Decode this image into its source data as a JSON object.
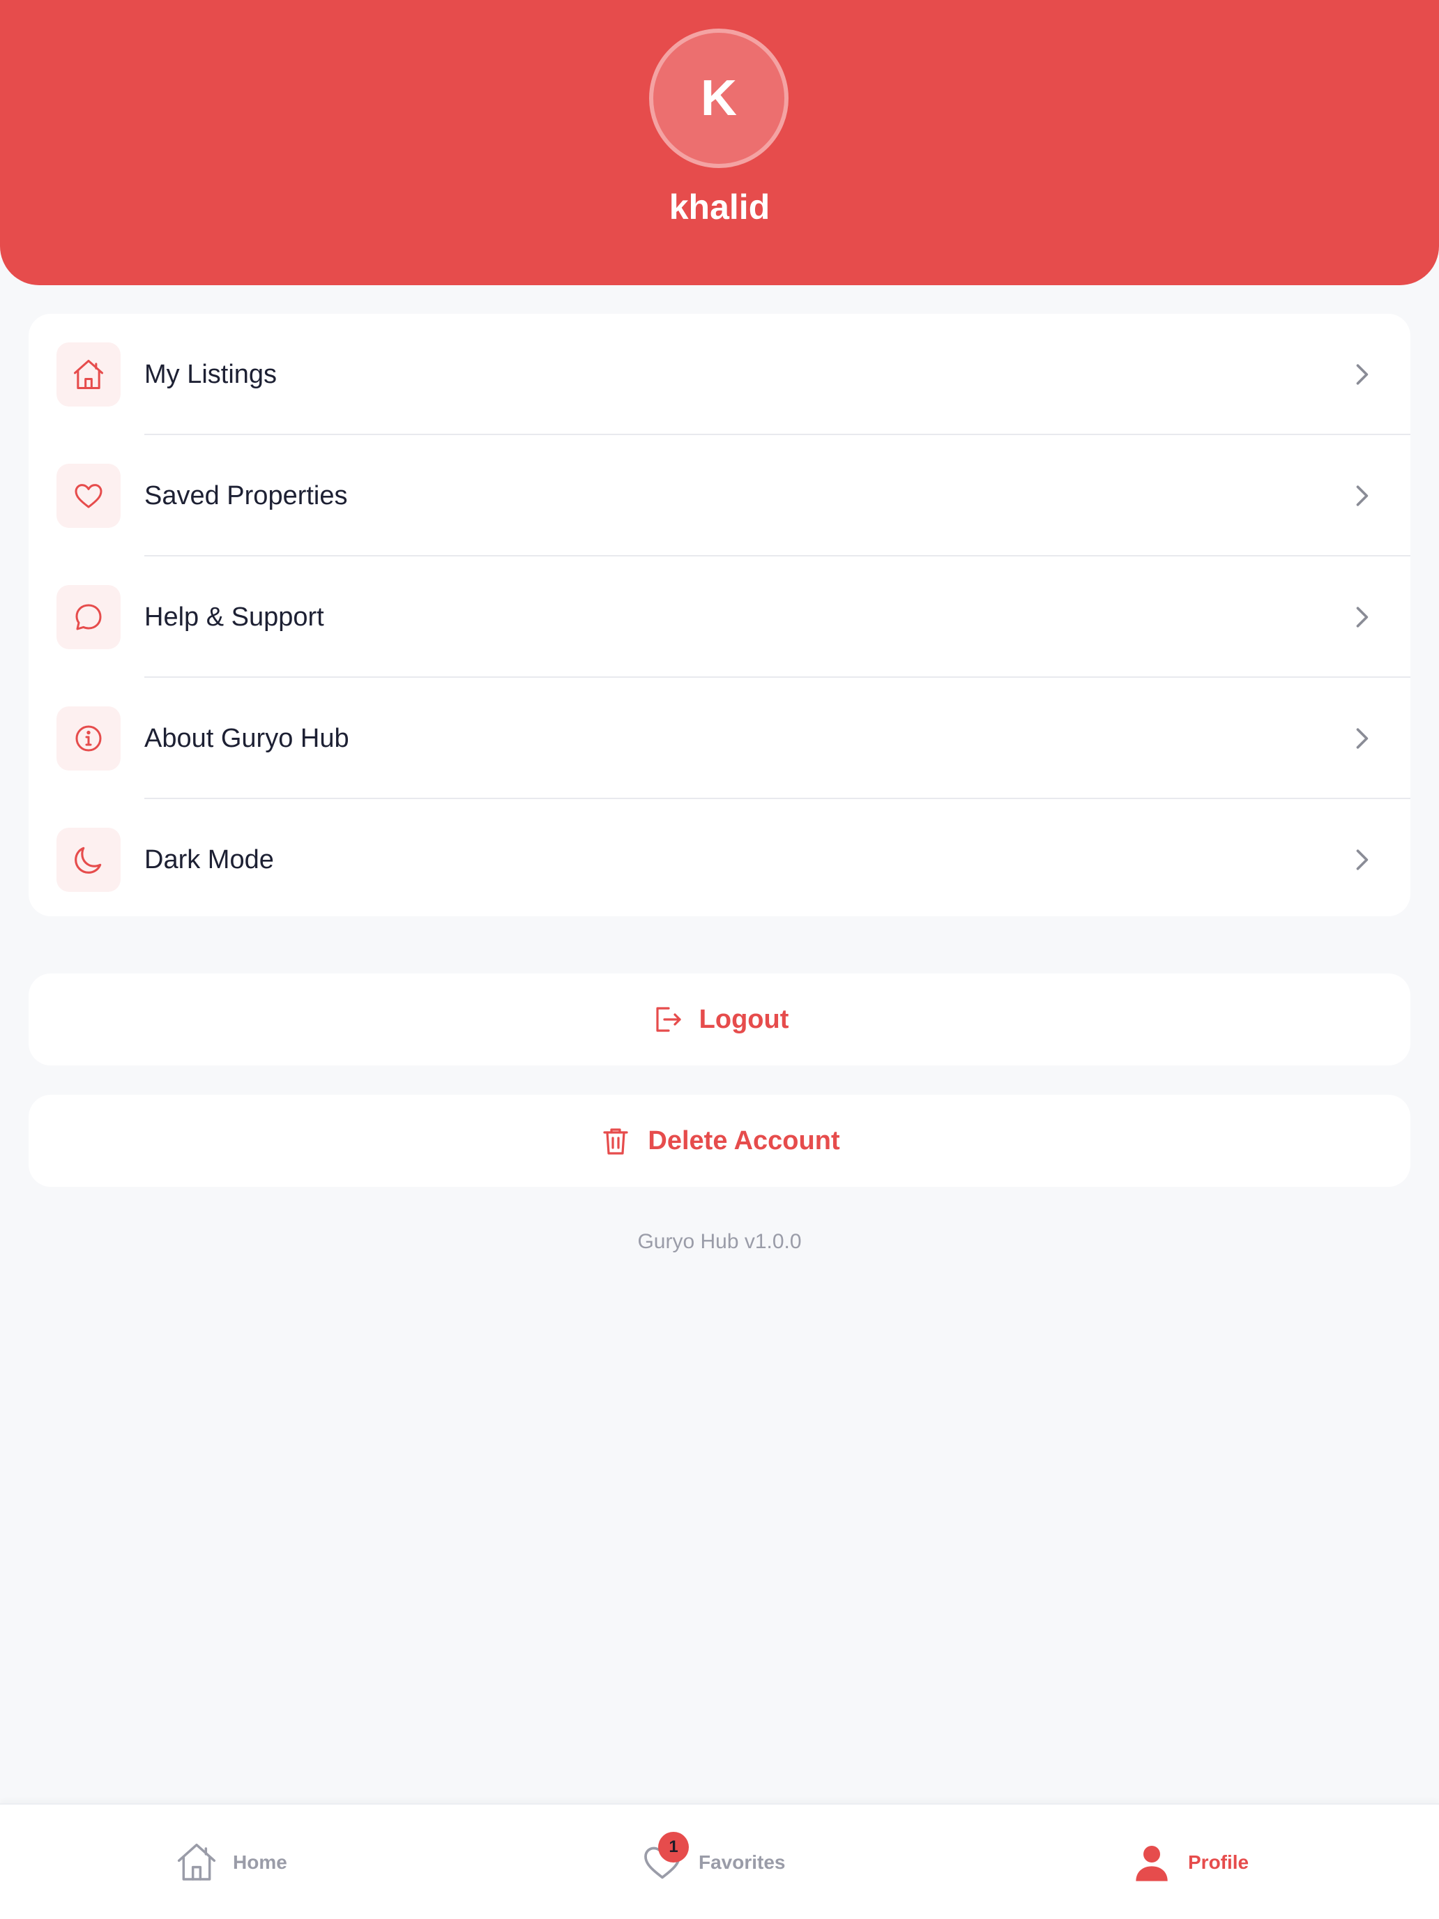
{
  "user": {
    "initial": "K",
    "name": "khalid"
  },
  "menu": {
    "items": [
      {
        "label": "My Listings",
        "icon": "home-icon"
      },
      {
        "label": "Saved Properties",
        "icon": "heart-icon"
      },
      {
        "label": "Help & Support",
        "icon": "chat-bubble-icon"
      },
      {
        "label": "About Guryo Hub",
        "icon": "info-icon"
      },
      {
        "label": "Dark Mode",
        "icon": "moon-icon"
      }
    ]
  },
  "actions": {
    "logout_label": "Logout",
    "delete_label": "Delete Account"
  },
  "version": "Guryo Hub v1.0.0",
  "tabbar": {
    "home_label": "Home",
    "favorites_label": "Favorites",
    "favorites_badge": "1",
    "profile_label": "Profile",
    "active_tab": "Profile"
  },
  "colors": {
    "accent": "#e64c4c",
    "background": "#f7f8fa",
    "card": "#ffffff",
    "inactive": "#9a9ca8"
  }
}
